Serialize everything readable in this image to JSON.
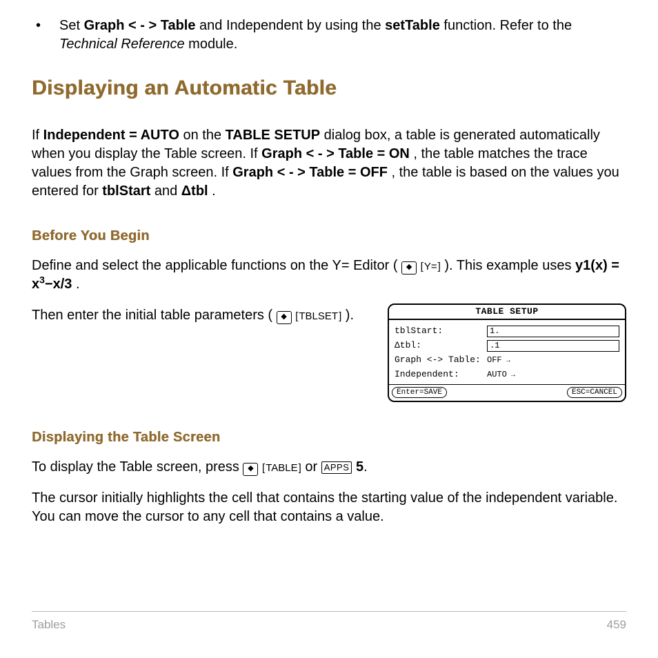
{
  "bullet": {
    "pre": "Set ",
    "graph_table": "Graph < - > Table",
    "mid1": " and Independent by using the ",
    "setTable": "setTable",
    "mid2": " function. Refer to the ",
    "techref": "Technical Reference",
    "post": " module."
  },
  "heading_main": "Displaying an Automatic Table",
  "intro": {
    "p1a": "If ",
    "indep_auto": "Independent = AUTO",
    "p1b": " on the ",
    "table_setup": "TABLE SETUP",
    "p1c": " dialog box, a table is generated automatically when you display the Table screen. If ",
    "gt_on": "Graph < - > Table = ON",
    "p1d": ", the table matches the trace values from the Graph screen. If ",
    "gt_off": "Graph < - > Table = OFF",
    "p1e": ", the table is based on the values you entered for ",
    "tblstart": "tblStart",
    "p1f": " and ",
    "dtbl": "Δtbl",
    "p1g": "."
  },
  "sec_before": "Before You Begin",
  "before_p1a": "Define and select the applicable functions on the Y= Editor (",
  "key_y": "Y=",
  "before_p1b": "). This example uses ",
  "formula_pre": "y1(x) = x",
  "formula_sup": "3",
  "formula_post": "−x/3",
  "formula_period": ".",
  "before_p2a": "Then enter the initial table parameters (",
  "key_tblset": "TBLSET",
  "before_p2b": ").",
  "calc": {
    "title": "TABLE SETUP",
    "r1": "tblStart:",
    "r1v": "1.",
    "r2": "Δtbl:",
    "r2v": ".1",
    "r3": "Graph <-> Table:",
    "r3v": "OFF",
    "r4": "Independent:",
    "r4v": "AUTO",
    "save": "Enter=SAVE",
    "cancel": "ESC=CANCEL"
  },
  "sec_display": "Displaying the Table Screen",
  "display_p1a": "To display the Table screen, press ",
  "key_table": "TABLE",
  "display_or": " or ",
  "key_apps": "APPS",
  "display_5": " 5",
  "display_p1b": ".",
  "display_p2": "The cursor initially highlights the cell that contains the starting value of the independent variable. You can move the cursor to any cell that contains a value.",
  "footer_left": "Tables",
  "footer_right": "459"
}
